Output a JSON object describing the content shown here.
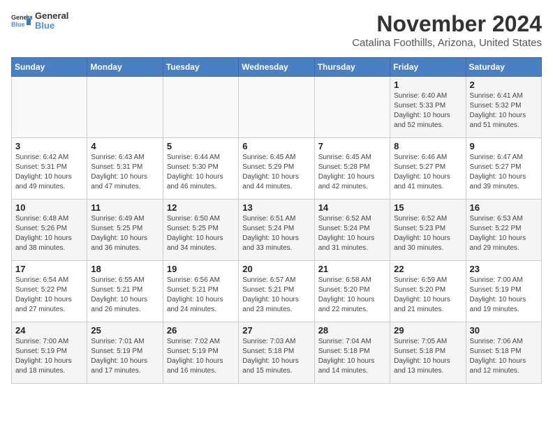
{
  "header": {
    "logo_general": "General",
    "logo_blue": "Blue",
    "month_title": "November 2024",
    "location": "Catalina Foothills, Arizona, United States"
  },
  "weekdays": [
    "Sunday",
    "Monday",
    "Tuesday",
    "Wednesday",
    "Thursday",
    "Friday",
    "Saturday"
  ],
  "weeks": [
    [
      {
        "day": "",
        "info": ""
      },
      {
        "day": "",
        "info": ""
      },
      {
        "day": "",
        "info": ""
      },
      {
        "day": "",
        "info": ""
      },
      {
        "day": "",
        "info": ""
      },
      {
        "day": "1",
        "info": "Sunrise: 6:40 AM\nSunset: 5:33 PM\nDaylight: 10 hours and 52 minutes."
      },
      {
        "day": "2",
        "info": "Sunrise: 6:41 AM\nSunset: 5:32 PM\nDaylight: 10 hours and 51 minutes."
      }
    ],
    [
      {
        "day": "3",
        "info": "Sunrise: 6:42 AM\nSunset: 5:31 PM\nDaylight: 10 hours and 49 minutes."
      },
      {
        "day": "4",
        "info": "Sunrise: 6:43 AM\nSunset: 5:31 PM\nDaylight: 10 hours and 47 minutes."
      },
      {
        "day": "5",
        "info": "Sunrise: 6:44 AM\nSunset: 5:30 PM\nDaylight: 10 hours and 46 minutes."
      },
      {
        "day": "6",
        "info": "Sunrise: 6:45 AM\nSunset: 5:29 PM\nDaylight: 10 hours and 44 minutes."
      },
      {
        "day": "7",
        "info": "Sunrise: 6:45 AM\nSunset: 5:28 PM\nDaylight: 10 hours and 42 minutes."
      },
      {
        "day": "8",
        "info": "Sunrise: 6:46 AM\nSunset: 5:27 PM\nDaylight: 10 hours and 41 minutes."
      },
      {
        "day": "9",
        "info": "Sunrise: 6:47 AM\nSunset: 5:27 PM\nDaylight: 10 hours and 39 minutes."
      }
    ],
    [
      {
        "day": "10",
        "info": "Sunrise: 6:48 AM\nSunset: 5:26 PM\nDaylight: 10 hours and 38 minutes."
      },
      {
        "day": "11",
        "info": "Sunrise: 6:49 AM\nSunset: 5:25 PM\nDaylight: 10 hours and 36 minutes."
      },
      {
        "day": "12",
        "info": "Sunrise: 6:50 AM\nSunset: 5:25 PM\nDaylight: 10 hours and 34 minutes."
      },
      {
        "day": "13",
        "info": "Sunrise: 6:51 AM\nSunset: 5:24 PM\nDaylight: 10 hours and 33 minutes."
      },
      {
        "day": "14",
        "info": "Sunrise: 6:52 AM\nSunset: 5:24 PM\nDaylight: 10 hours and 31 minutes."
      },
      {
        "day": "15",
        "info": "Sunrise: 6:52 AM\nSunset: 5:23 PM\nDaylight: 10 hours and 30 minutes."
      },
      {
        "day": "16",
        "info": "Sunrise: 6:53 AM\nSunset: 5:22 PM\nDaylight: 10 hours and 29 minutes."
      }
    ],
    [
      {
        "day": "17",
        "info": "Sunrise: 6:54 AM\nSunset: 5:22 PM\nDaylight: 10 hours and 27 minutes."
      },
      {
        "day": "18",
        "info": "Sunrise: 6:55 AM\nSunset: 5:21 PM\nDaylight: 10 hours and 26 minutes."
      },
      {
        "day": "19",
        "info": "Sunrise: 6:56 AM\nSunset: 5:21 PM\nDaylight: 10 hours and 24 minutes."
      },
      {
        "day": "20",
        "info": "Sunrise: 6:57 AM\nSunset: 5:21 PM\nDaylight: 10 hours and 23 minutes."
      },
      {
        "day": "21",
        "info": "Sunrise: 6:58 AM\nSunset: 5:20 PM\nDaylight: 10 hours and 22 minutes."
      },
      {
        "day": "22",
        "info": "Sunrise: 6:59 AM\nSunset: 5:20 PM\nDaylight: 10 hours and 21 minutes."
      },
      {
        "day": "23",
        "info": "Sunrise: 7:00 AM\nSunset: 5:19 PM\nDaylight: 10 hours and 19 minutes."
      }
    ],
    [
      {
        "day": "24",
        "info": "Sunrise: 7:00 AM\nSunset: 5:19 PM\nDaylight: 10 hours and 18 minutes."
      },
      {
        "day": "25",
        "info": "Sunrise: 7:01 AM\nSunset: 5:19 PM\nDaylight: 10 hours and 17 minutes."
      },
      {
        "day": "26",
        "info": "Sunrise: 7:02 AM\nSunset: 5:19 PM\nDaylight: 10 hours and 16 minutes."
      },
      {
        "day": "27",
        "info": "Sunrise: 7:03 AM\nSunset: 5:18 PM\nDaylight: 10 hours and 15 minutes."
      },
      {
        "day": "28",
        "info": "Sunrise: 7:04 AM\nSunset: 5:18 PM\nDaylight: 10 hours and 14 minutes."
      },
      {
        "day": "29",
        "info": "Sunrise: 7:05 AM\nSunset: 5:18 PM\nDaylight: 10 hours and 13 minutes."
      },
      {
        "day": "30",
        "info": "Sunrise: 7:06 AM\nSunset: 5:18 PM\nDaylight: 10 hours and 12 minutes."
      }
    ]
  ]
}
